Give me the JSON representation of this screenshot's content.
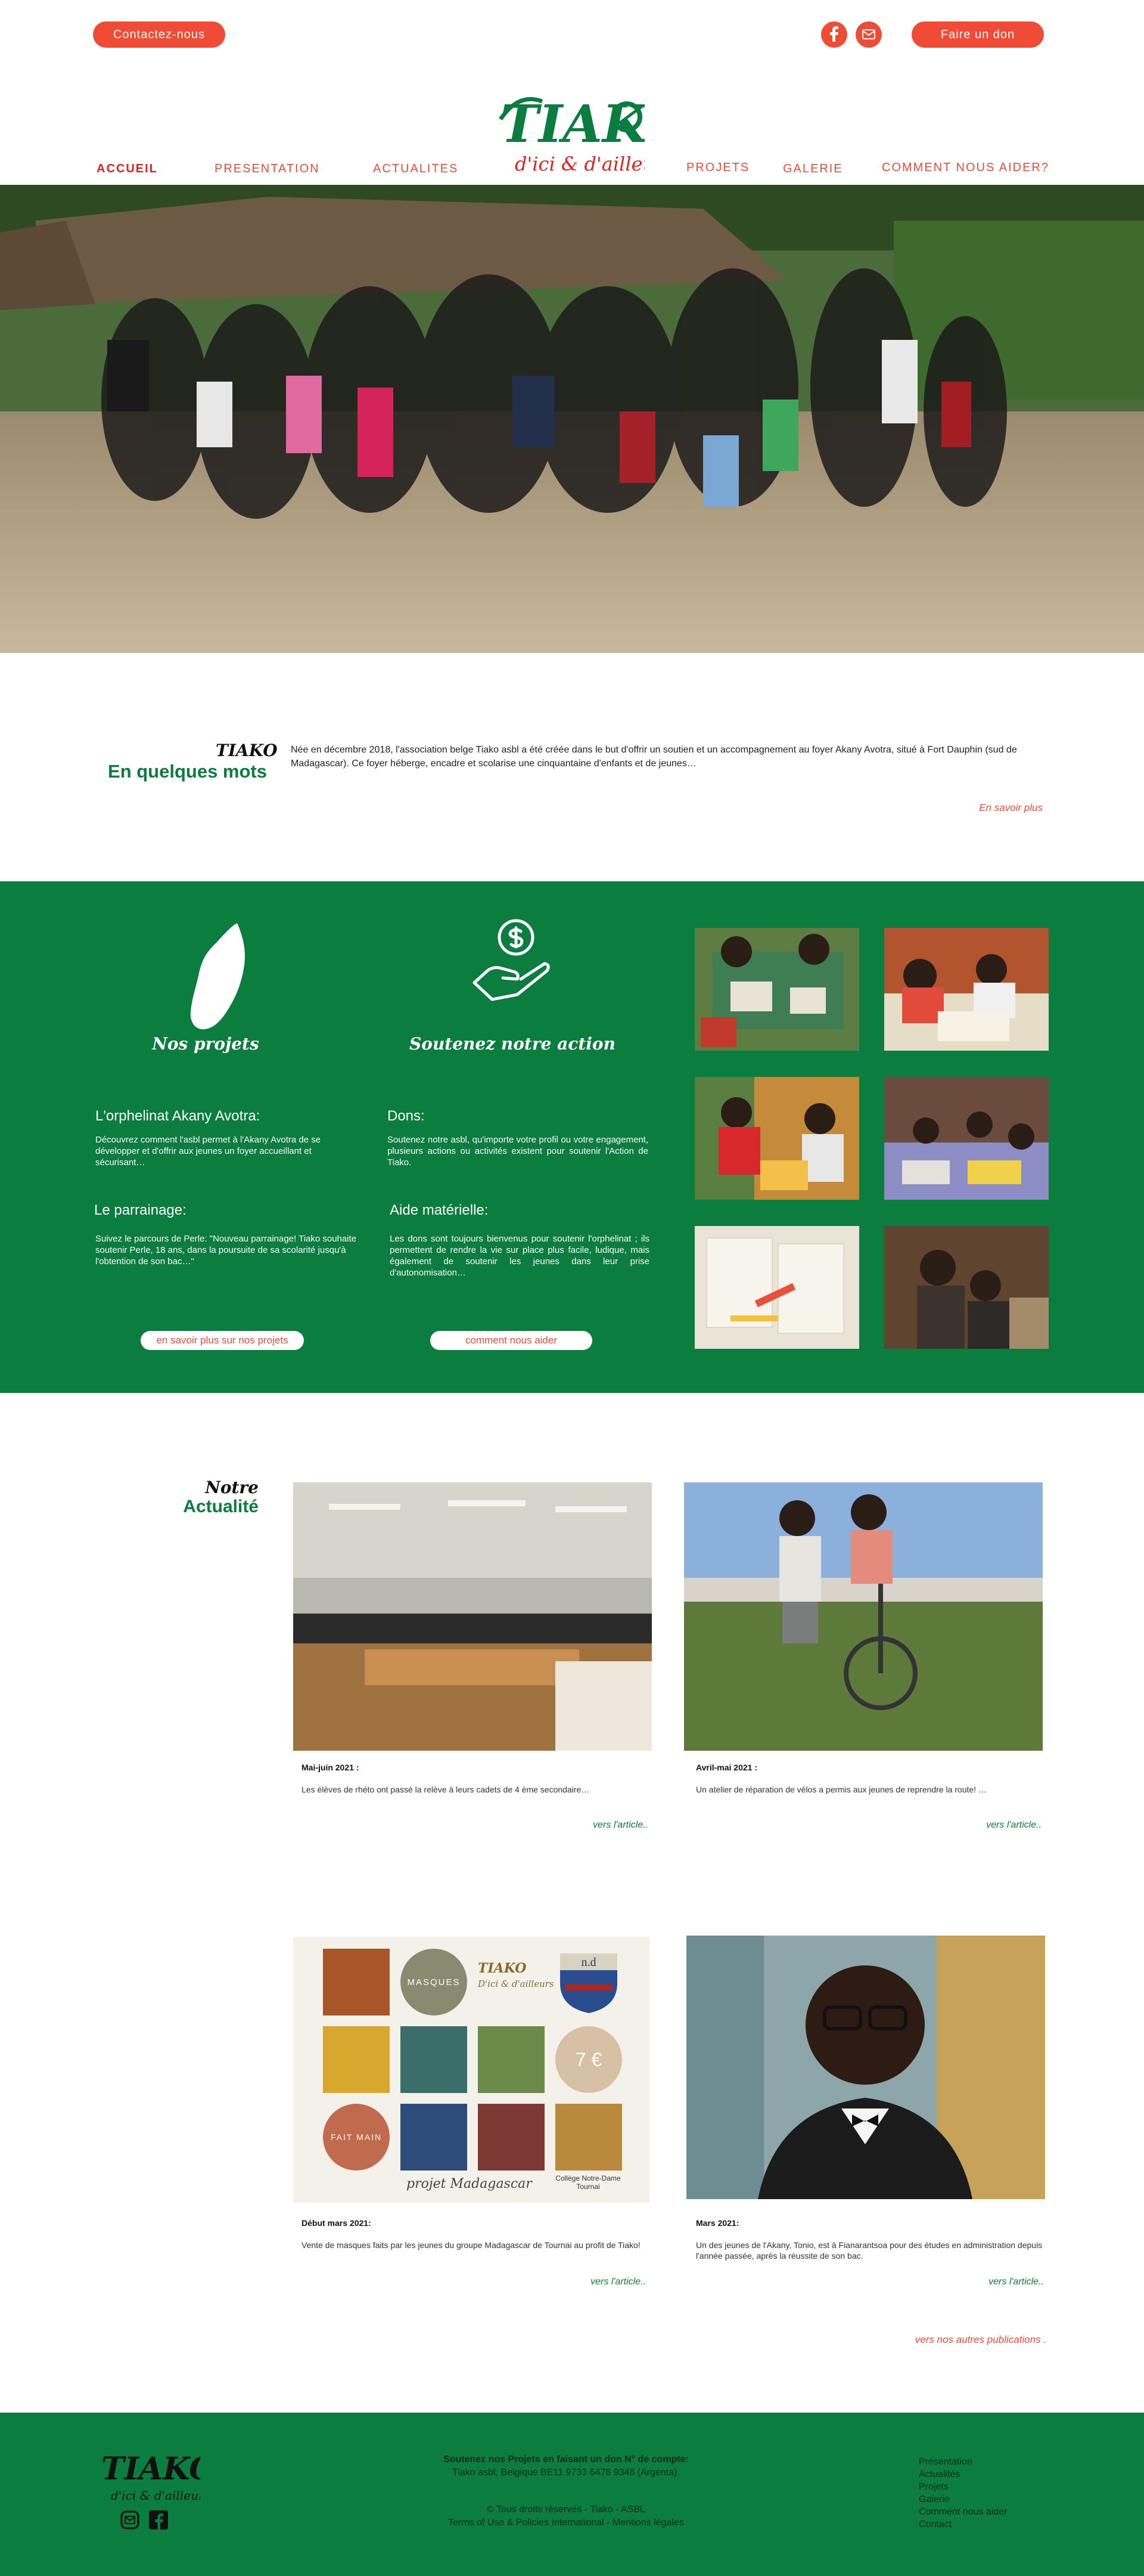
{
  "header": {
    "contact_label": "Contactez-nous",
    "donate_label": "Faire un don",
    "logo_text": "TIAKO",
    "logo_tagline": "d'ici & d'ailleurs"
  },
  "nav": {
    "items": [
      "ACCUEIL",
      "PRESENTATION",
      "ACTUALITES",
      "PROJETS",
      "GALERIE",
      "COMMENT NOUS AIDER?"
    ]
  },
  "intro": {
    "brand": "TIAKO",
    "title": "En quelques mots",
    "text": "Née en décembre 2018, l'association belge Tiako asbl a été créée dans le but d'offrir un soutien et un accompagnement au foyer Akany Avotra, situé à Fort Dauphin (sud de Madagascar). Ce foyer héberge, encadre et scolarise une cinquantaine d'enfants et de jeunes…",
    "more_link": "En savoir plus"
  },
  "projects": {
    "col1_title": "Nos projets",
    "col2_title": "Soutenez notre action",
    "block1_title": "L'orphelinat Akany Avotra:",
    "block1_text": "Découvrez comment l'asbl permet à l'Akany Avotra de se développer  et d'offrir aux jeunes un foyer accueillant et sécurisant…",
    "block2_title": "Le parrainage:",
    "block2_text": "Suivez le parcours de Perle: \"Nouveau parrainage! Tiako souhaite soutenir Perle, 18 ans, dans la poursuite de sa scolarité jusqu'à l'obtention de son bac…\"",
    "block3_title": "Dons:",
    "block3_text": "Soutenez notre asbl, qu'importe votre profil ou votre engagement, plusieurs actions ou activités existent pour soutenir l'Action de Tiako.",
    "block4_title": "Aide matérielle:",
    "block4_text": "Les dons sont toujours bienvenus pour soutenir l'orphelinat ; ils permettent de rendre la vie sur place plus facile, ludique, mais également de soutenir les jeunes dans leur prise d'autonomisation…",
    "btn1": "en savoir plus sur nos projets",
    "btn2": "comment nous aider"
  },
  "news": {
    "title_script": "Notre",
    "title": "Actualité",
    "items": [
      {
        "date": "Mai-juin 2021 :",
        "text": "Les élèves de rhéto ont passé la relève à leurs cadets de 4 ème secondaire…",
        "link": "vers l'article.."
      },
      {
        "date": "Avril-mai 2021 :",
        "text": "Un atelier de réparation de vélos a permis aux jeunes de reprendre la route! …",
        "link": "vers l'article.."
      },
      {
        "date": "Début mars 2021:",
        "text": "Vente de masques faits par les jeunes du groupe Madagascar de Tournai au profit de Tiako!",
        "link": "vers l'article.."
      },
      {
        "date": "Mars 2021:",
        "text": "Un des jeunes de l'Akany, Tonio, est à Fianarantsoa pour des études en administration depuis l'année passée, après la réussite de son bac.",
        "link": "vers l'article.."
      }
    ],
    "more": "vers nos autres publications .",
    "poster": {
      "brand": "TIAKO",
      "tagline": "D'ici & d'ailleurs",
      "word1": "MASQUES",
      "price": "7 €",
      "word2": "FAIT MAIN",
      "caption": "projet Madagascar",
      "school": "Collège Notre-Dame Tournai",
      "crest_text": "n.d"
    }
  },
  "footer": {
    "logo_text": "TIAKO",
    "logo_tagline": "d'ici & d'ailleurs",
    "support_title": "Soutenez nos Projets en faisant un don N° de compte:",
    "account": "Tiako asbl, Belgique BE11 9733 6478 9348 (Argenta).",
    "copyright": "© Tous droits réservés  -  Tiako - ASBL",
    "legal": "Terms of Use & Policies International  -  Mentions légales",
    "links": [
      "Présentation",
      "Actualités",
      "Projets",
      "Galerie",
      "Comment nous aider",
      "Contact"
    ]
  },
  "colors": {
    "accent": "#ef4b35",
    "green": "#0b7d3f"
  }
}
